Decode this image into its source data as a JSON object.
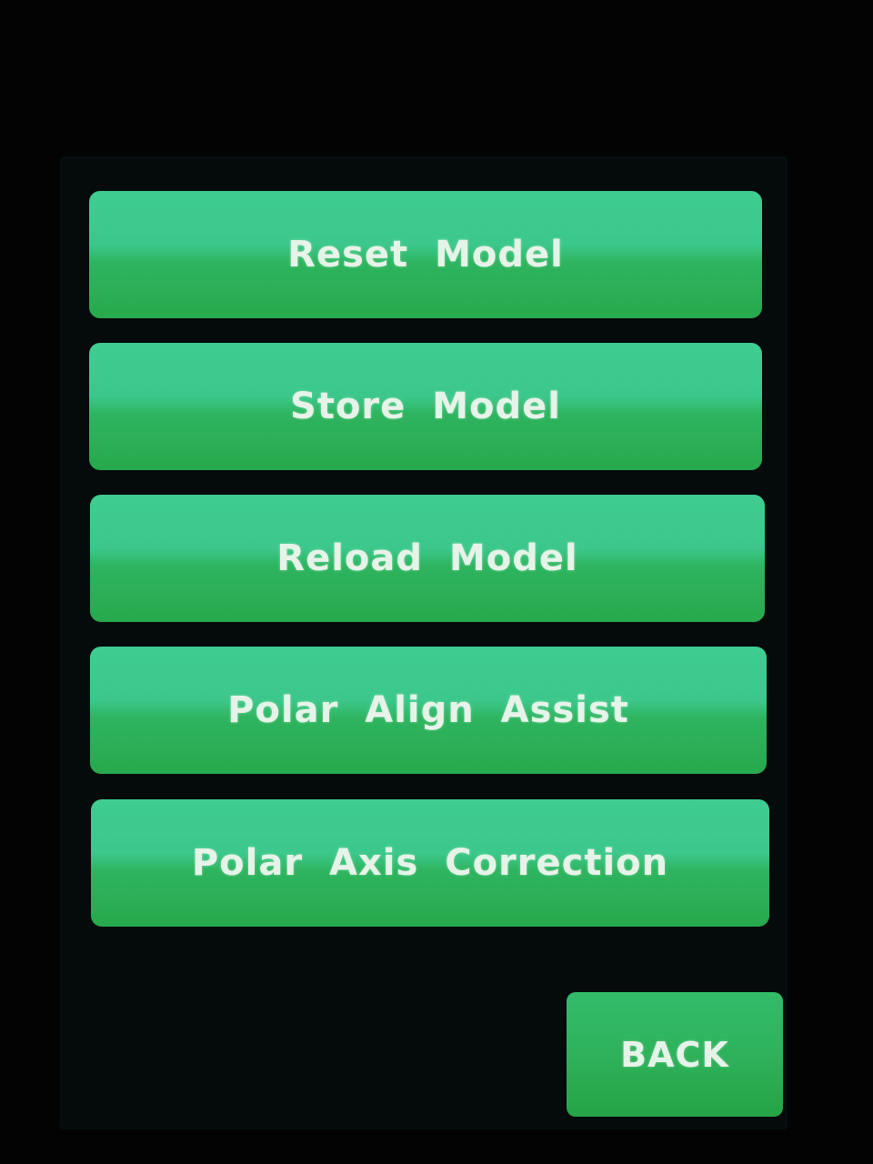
{
  "menu": {
    "buttons": [
      {
        "label": "Reset Model"
      },
      {
        "label": "Store Model"
      },
      {
        "label": "Reload Model"
      },
      {
        "label": "Polar Align Assist"
      },
      {
        "label": "Polar Axis Correction"
      }
    ],
    "back_label": "BACK"
  },
  "colors": {
    "button_top": "#3fcc91",
    "button_bottom": "#27a94d",
    "label_text": "#e6f3e9",
    "background": "#020302"
  }
}
